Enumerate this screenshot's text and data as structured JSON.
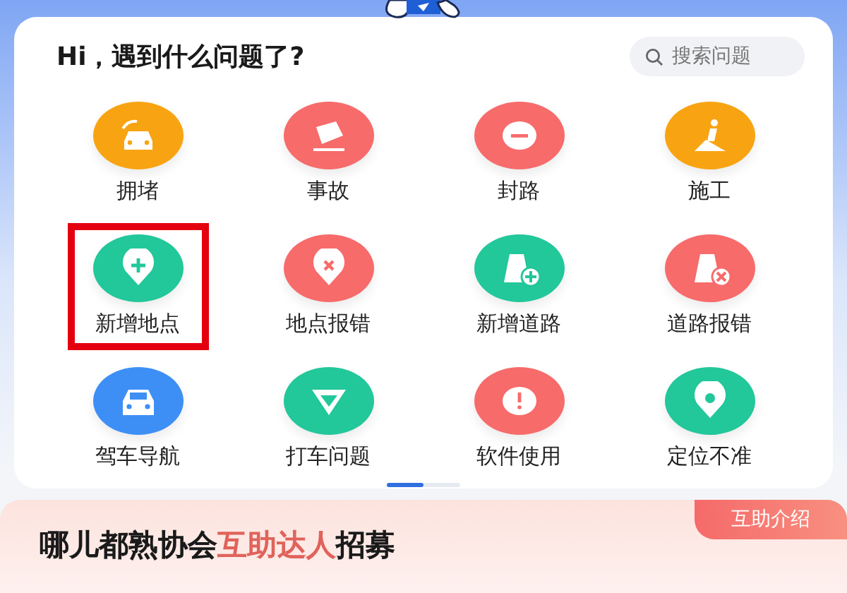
{
  "greeting": "Hi，遇到什么问题了?",
  "search": {
    "placeholder": "搜索问题"
  },
  "items": [
    {
      "label": "拥堵",
      "kind": "traffic",
      "color": "#f8a412",
      "highlighted": false
    },
    {
      "label": "事故",
      "kind": "accident",
      "color": "#f76b6b",
      "highlighted": false
    },
    {
      "label": "封路",
      "kind": "closed",
      "color": "#f76b6b",
      "highlighted": false
    },
    {
      "label": "施工",
      "kind": "construction",
      "color": "#f8a412",
      "highlighted": false
    },
    {
      "label": "新增地点",
      "kind": "add-place",
      "color": "#22c79a",
      "highlighted": true
    },
    {
      "label": "地点报错",
      "kind": "place-error",
      "color": "#f76b6b",
      "highlighted": false
    },
    {
      "label": "新增道路",
      "kind": "add-road",
      "color": "#22c79a",
      "highlighted": false
    },
    {
      "label": "道路报错",
      "kind": "road-error",
      "color": "#f76b6b",
      "highlighted": false
    },
    {
      "label": "驾车导航",
      "kind": "drive",
      "color": "#3d8ff5",
      "highlighted": false
    },
    {
      "label": "打车问题",
      "kind": "taxi",
      "color": "#22c79a",
      "highlighted": false
    },
    {
      "label": "软件使用",
      "kind": "app",
      "color": "#f76b6b",
      "highlighted": false
    },
    {
      "label": "定位不准",
      "kind": "location",
      "color": "#22c79a",
      "highlighted": false
    }
  ],
  "pager": [
    {
      "selected": true
    },
    {
      "selected": false
    }
  ],
  "banner": {
    "tag": "互助介绍",
    "title_parts": [
      {
        "text": "哪儿都熟协会",
        "accent": false
      },
      {
        "text": "互助达人",
        "accent": true
      },
      {
        "text": "招募",
        "accent": false
      }
    ]
  }
}
